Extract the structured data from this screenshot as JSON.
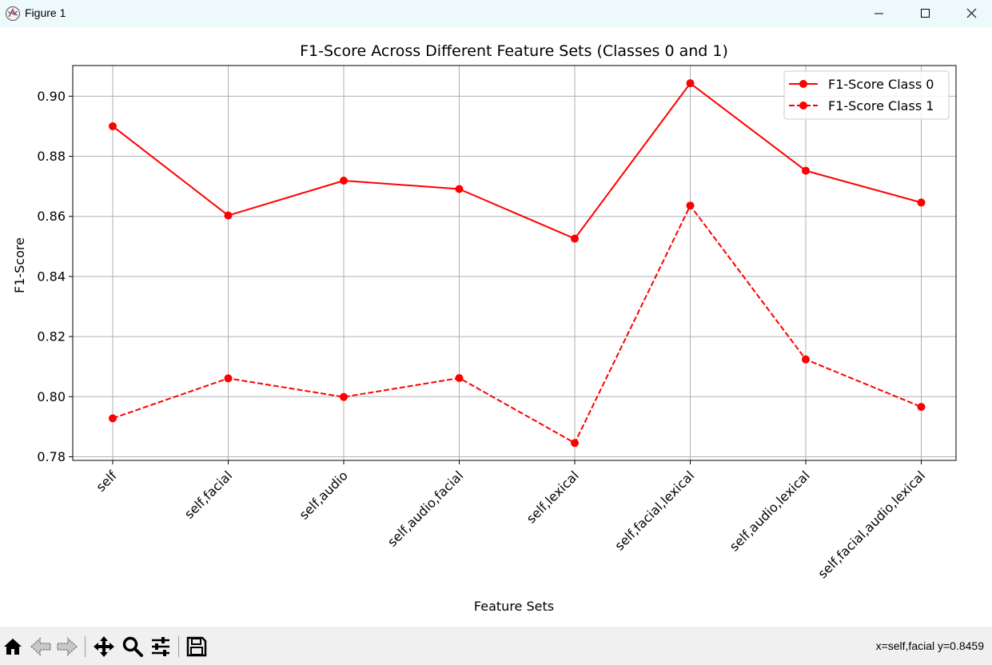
{
  "window": {
    "title": "Figure 1",
    "icons": [
      "figure-app-icon",
      "minimize-icon",
      "maximize-icon",
      "close-icon"
    ]
  },
  "toolbar": {
    "buttons": [
      "home-icon",
      "back-icon",
      "forward-icon",
      "pan-icon",
      "zoom-icon",
      "configure-subplots-icon",
      "save-icon"
    ],
    "status": "x=self,facial y=0.8459"
  },
  "colors": {
    "series": "#ff0000",
    "grid": "#b0b0b0",
    "titlebar": "#eef9fc",
    "toolbar": "#f0f0f0"
  },
  "chart_data": {
    "type": "line",
    "title": "F1-Score Across Different Feature Sets (Classes 0 and 1)",
    "xlabel": "Feature Sets",
    "ylabel": "F1-Score",
    "categories": [
      "self",
      "self,facial",
      "self,audio",
      "self,audio,facial",
      "self,lexical",
      "self,facial,lexical",
      "self,audio,lexical",
      "self,facial,audio,lexical"
    ],
    "series": [
      {
        "name": "F1-Score Class 0",
        "values": [
          0.89,
          0.8603,
          0.8719,
          0.8691,
          0.8526,
          0.9043,
          0.8752,
          0.8646
        ],
        "linestyle": "solid",
        "marker": "o",
        "color": "#ff0000"
      },
      {
        "name": "F1-Score Class 1",
        "values": [
          0.7928,
          0.8061,
          0.7999,
          0.8062,
          0.7846,
          0.8636,
          0.8124,
          0.7966
        ],
        "linestyle": "dashed",
        "marker": "o",
        "color": "#ff0000"
      }
    ],
    "ylim": [
      0.7788,
      0.9102
    ],
    "yticks": [
      "0.78",
      "0.80",
      "0.82",
      "0.84",
      "0.86",
      "0.88",
      "0.90"
    ],
    "grid": true,
    "legend_position": "upper right",
    "xtick_rotation": 45
  }
}
